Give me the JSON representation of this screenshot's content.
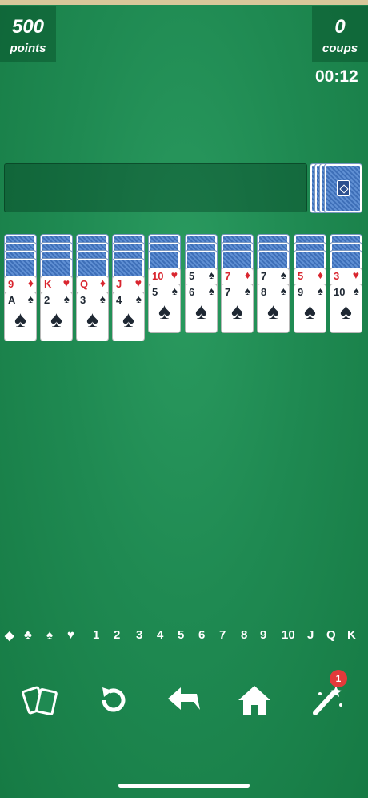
{
  "header": {
    "points_value": "500",
    "points_label": "points",
    "moves_value": "0",
    "moves_label": "coups",
    "timer": "00:12"
  },
  "columns": [
    {
      "down": 4,
      "up": [
        {
          "rank": "9",
          "suit": "♦",
          "color": "red"
        },
        {
          "rank": "A",
          "suit": "♠",
          "color": "black"
        }
      ]
    },
    {
      "down": 4,
      "up": [
        {
          "rank": "K",
          "suit": "♥",
          "color": "red"
        },
        {
          "rank": "2",
          "suit": "♠",
          "color": "black"
        }
      ]
    },
    {
      "down": 4,
      "up": [
        {
          "rank": "Q",
          "suit": "♦",
          "color": "red"
        },
        {
          "rank": "3",
          "suit": "♠",
          "color": "black"
        }
      ]
    },
    {
      "down": 4,
      "up": [
        {
          "rank": "J",
          "suit": "♥",
          "color": "red"
        },
        {
          "rank": "4",
          "suit": "♠",
          "color": "black"
        }
      ]
    },
    {
      "down": 3,
      "up": [
        {
          "rank": "10",
          "suit": "♥",
          "color": "red"
        },
        {
          "rank": "5",
          "suit": "♠",
          "color": "black"
        }
      ]
    },
    {
      "down": 3,
      "up": [
        {
          "rank": "5",
          "suit": "♠",
          "color": "black"
        },
        {
          "rank": "6",
          "suit": "♠",
          "color": "black"
        }
      ]
    },
    {
      "down": 3,
      "up": [
        {
          "rank": "7",
          "suit": "♦",
          "color": "red"
        },
        {
          "rank": "7",
          "suit": "♠",
          "color": "black"
        }
      ]
    },
    {
      "down": 3,
      "up": [
        {
          "rank": "7",
          "suit": "♠",
          "color": "black"
        },
        {
          "rank": "8",
          "suit": "♠",
          "color": "black"
        }
      ]
    },
    {
      "down": 3,
      "up": [
        {
          "rank": "5",
          "suit": "♦",
          "color": "red"
        },
        {
          "rank": "9",
          "suit": "♠",
          "color": "black"
        }
      ]
    },
    {
      "down": 3,
      "up": [
        {
          "rank": "3",
          "suit": "♥",
          "color": "red"
        },
        {
          "rank": "10",
          "suit": "♠",
          "color": "black"
        }
      ]
    }
  ],
  "legend": [
    "◆",
    "♣",
    "♠",
    "♥",
    "1",
    "2",
    "3",
    "4",
    "5",
    "6",
    "7",
    "8",
    "9",
    "10",
    "J",
    "Q",
    "K"
  ],
  "toolbar": {
    "buttons": [
      "cards-icon",
      "restart-icon",
      "undo-icon",
      "home-icon",
      "magic-wand-icon"
    ],
    "hint_badge": "1"
  },
  "colors": {
    "felt": "#1f8a52",
    "card_back": "#4a7cc4",
    "red_suit": "#d9262f",
    "badge": "#e23a3a"
  }
}
